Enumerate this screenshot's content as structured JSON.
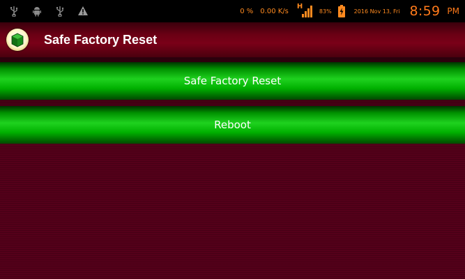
{
  "status_bar": {
    "icons": [
      "usb-icon",
      "android-debug-icon",
      "usb-icon",
      "warning-icon"
    ],
    "cpu": "0 %",
    "network_speed": "0.00 K/s",
    "signal_type": "H",
    "battery": "83%",
    "date": "2016 Nov 13, Fri",
    "time": "8:59",
    "ampm": "PM",
    "accent_color": "#ff8a1f"
  },
  "action_bar": {
    "title": "Safe Factory Reset",
    "app_icon": "green-box-icon",
    "color": "#6a0014"
  },
  "buttons": {
    "safe_factory_reset": "Safe Factory Reset",
    "reboot": "Reboot",
    "color": "#1fd21f"
  }
}
